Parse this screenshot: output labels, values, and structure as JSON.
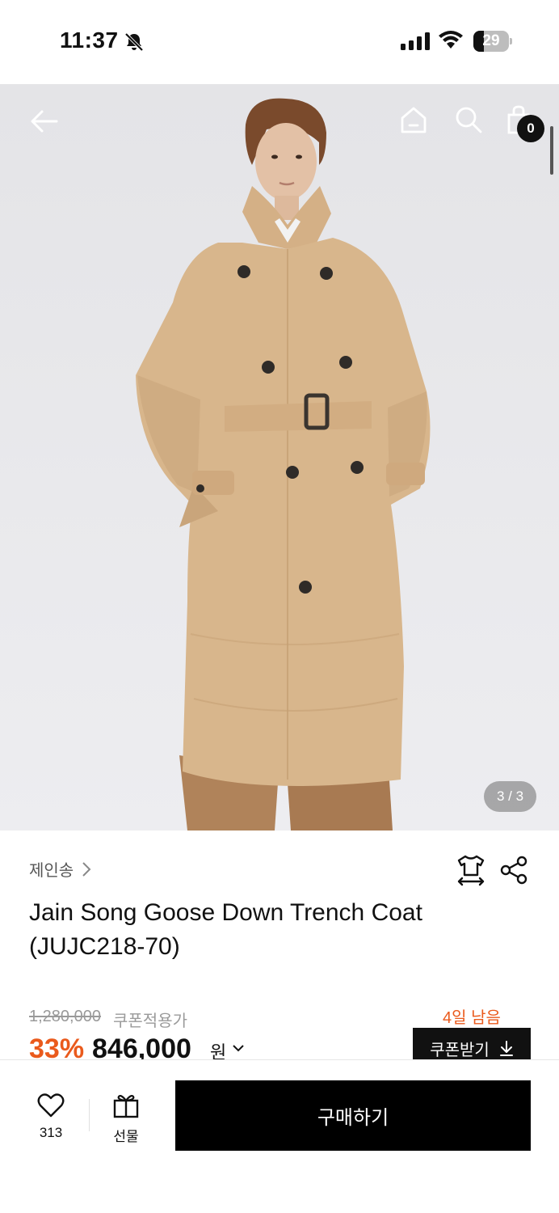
{
  "status_bar": {
    "time": "11:37",
    "battery_level": "29",
    "icons": [
      "bell-slash-icon",
      "signal-icon",
      "wifi-icon",
      "battery-icon"
    ]
  },
  "header": {
    "icons": [
      "back-arrow-icon",
      "home-icon",
      "search-icon",
      "shopping-bag-icon"
    ],
    "cart_count": "0"
  },
  "gallery": {
    "counter": "3 / 3"
  },
  "product": {
    "brand": "제인송",
    "title": "Jain Song Goose Down Trench Coat (JUJC218-70)",
    "action_icons": [
      "size-guide-icon",
      "share-icon"
    ]
  },
  "pricing": {
    "original_price": "1,280,000",
    "coupon_label": "쿠폰적용가",
    "days_left": "4일 남음",
    "discount": "33%",
    "sale_price": "846,000",
    "currency": "원",
    "coupon_button": "쿠폰받기"
  },
  "bottom_bar": {
    "like_count": "313",
    "gift_label": "선물",
    "buy_label": "구매하기"
  },
  "colors": {
    "accent": "#ea5a1c",
    "primary": "#000000",
    "coat": "#d9b88f"
  }
}
